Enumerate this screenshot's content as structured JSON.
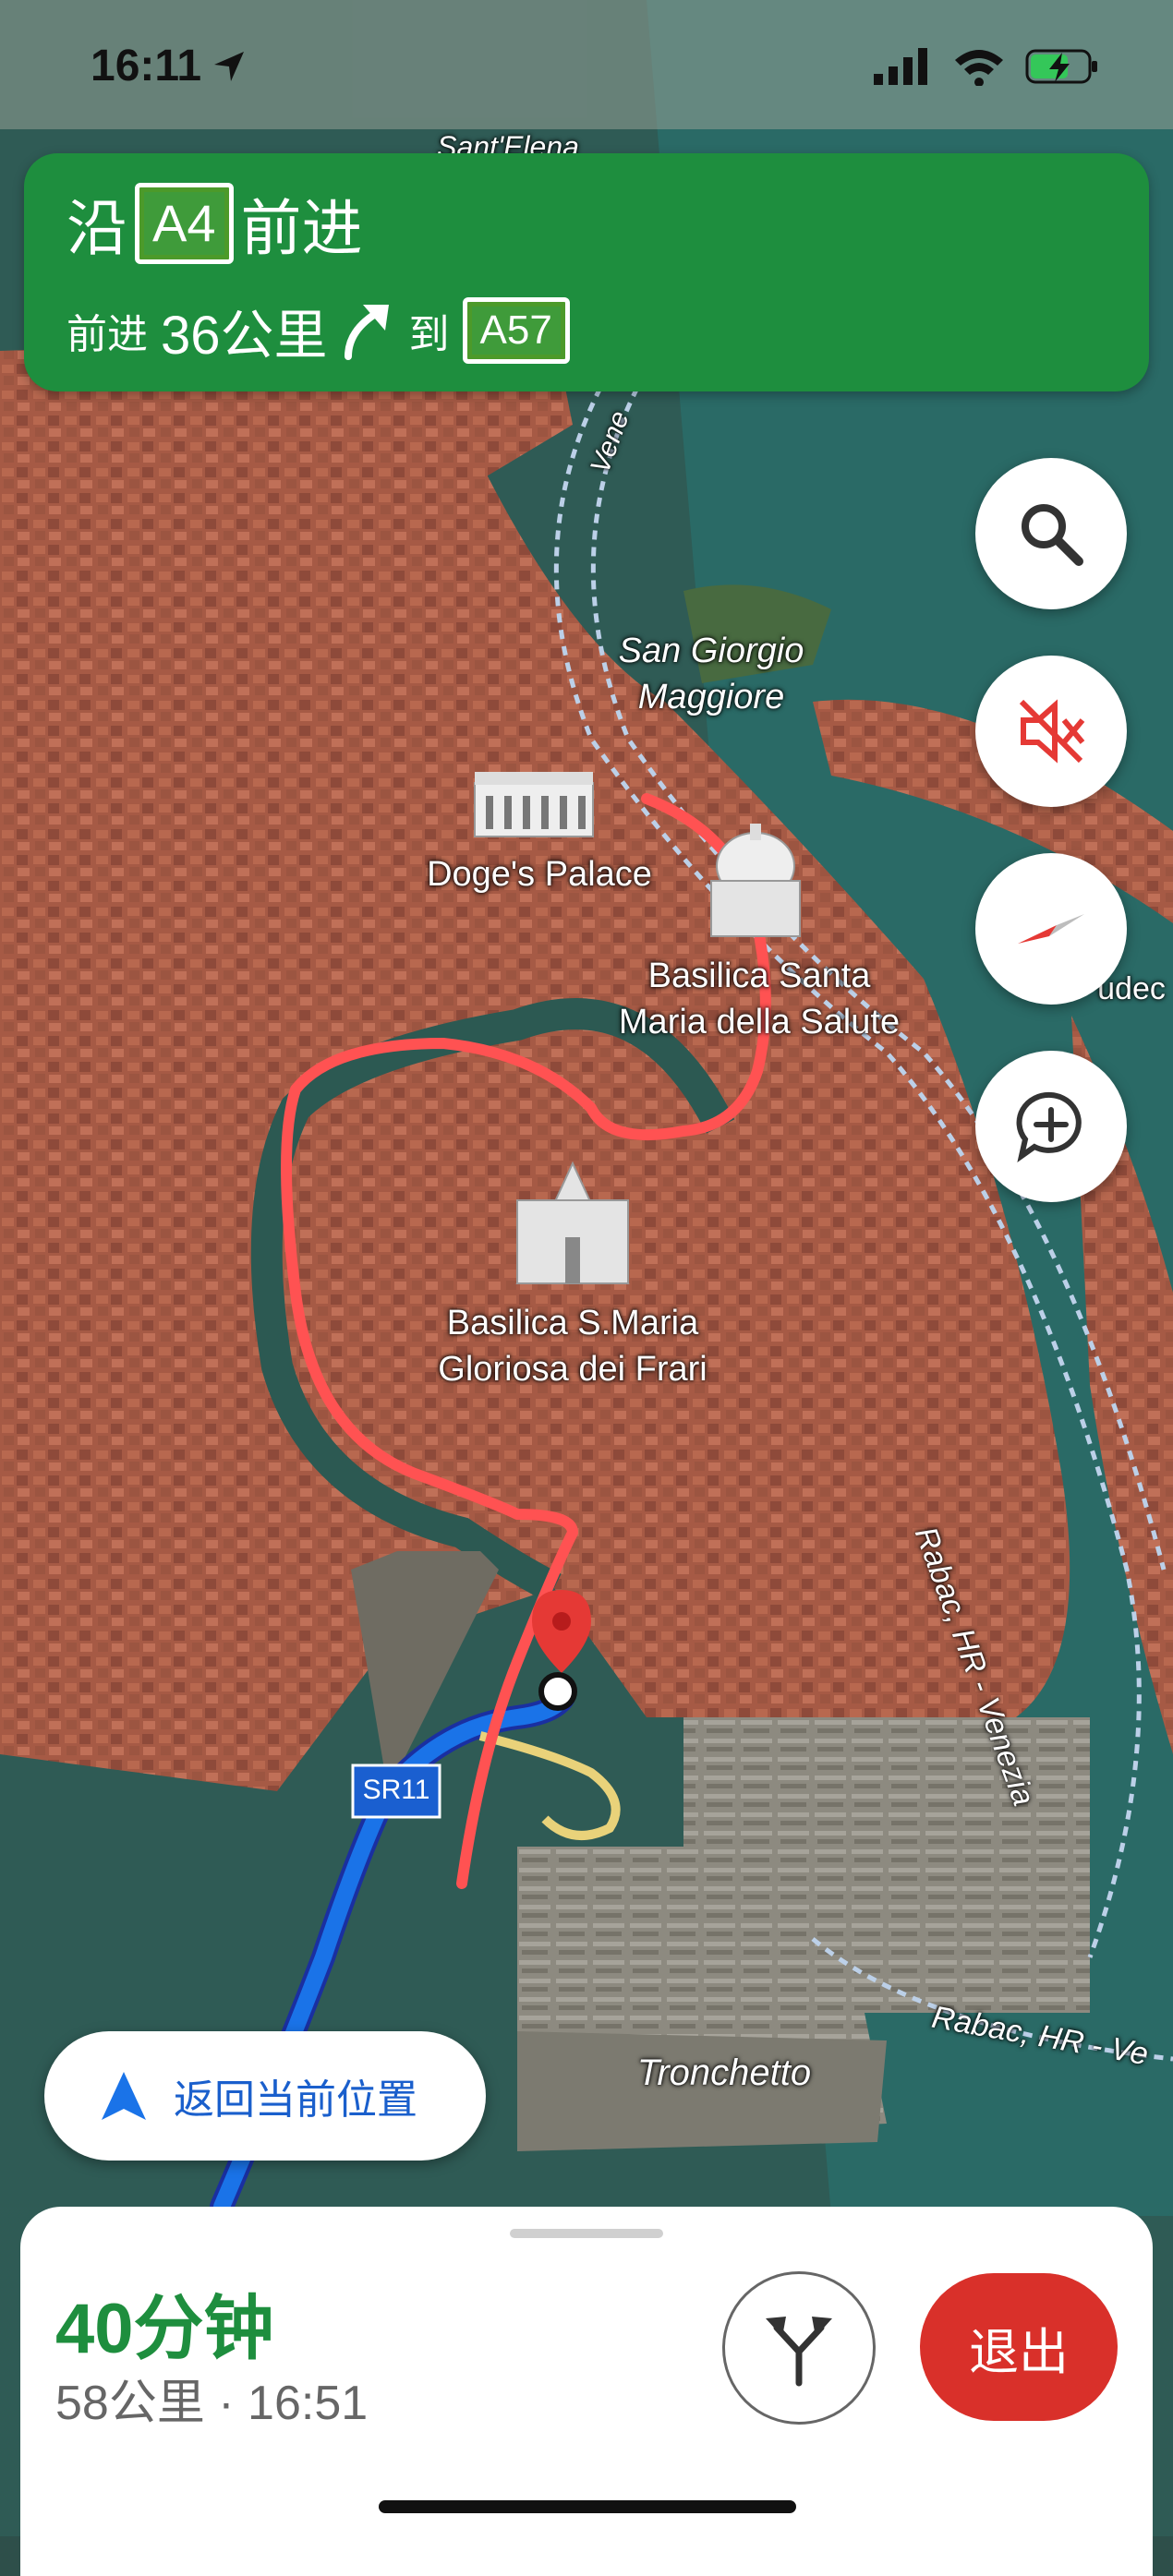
{
  "status_bar": {
    "time": "16:11"
  },
  "navigation": {
    "primary_prefix": "沿",
    "primary_road": "A4",
    "primary_suffix": "前进",
    "secondary_prefix": "前进",
    "secondary_distance": "36公里",
    "secondary_to": "到",
    "secondary_road": "A57",
    "banner_color": "#1e8e3e"
  },
  "map_labels": {
    "sant_elena": "Sant'Elena",
    "san_giorgio_1": "San Giorgio",
    "san_giorgio_2": "Maggiore",
    "doges_palace": "Doge's Palace",
    "salute_1": "Basilica Santa",
    "salute_2": "Maria della Salute",
    "frari_1": "Basilica S.Maria",
    "frari_2": "Gloriosa dei Frari",
    "road_sr11": "SR11",
    "rabac_1": "Rabac, HR - Venezia",
    "rabac_2": "Rabac, HR - Ve",
    "vene": "Vene",
    "tronchetto": "Tronchetto",
    "giudecca": "udec"
  },
  "controls": {
    "search_icon": "search-icon",
    "mute_icon": "volume-off-icon",
    "compass_icon": "compass-icon",
    "report_icon": "add-comment-icon"
  },
  "recenter": {
    "label": "返回当前位置"
  },
  "trip": {
    "eta_duration": "40分钟",
    "eta_details": "58公里 · 16:51",
    "exit_label": "退出",
    "route_color": "#1a73e8",
    "drawn_path_color": "#ff4a4a",
    "exit_color": "#d9302a"
  }
}
